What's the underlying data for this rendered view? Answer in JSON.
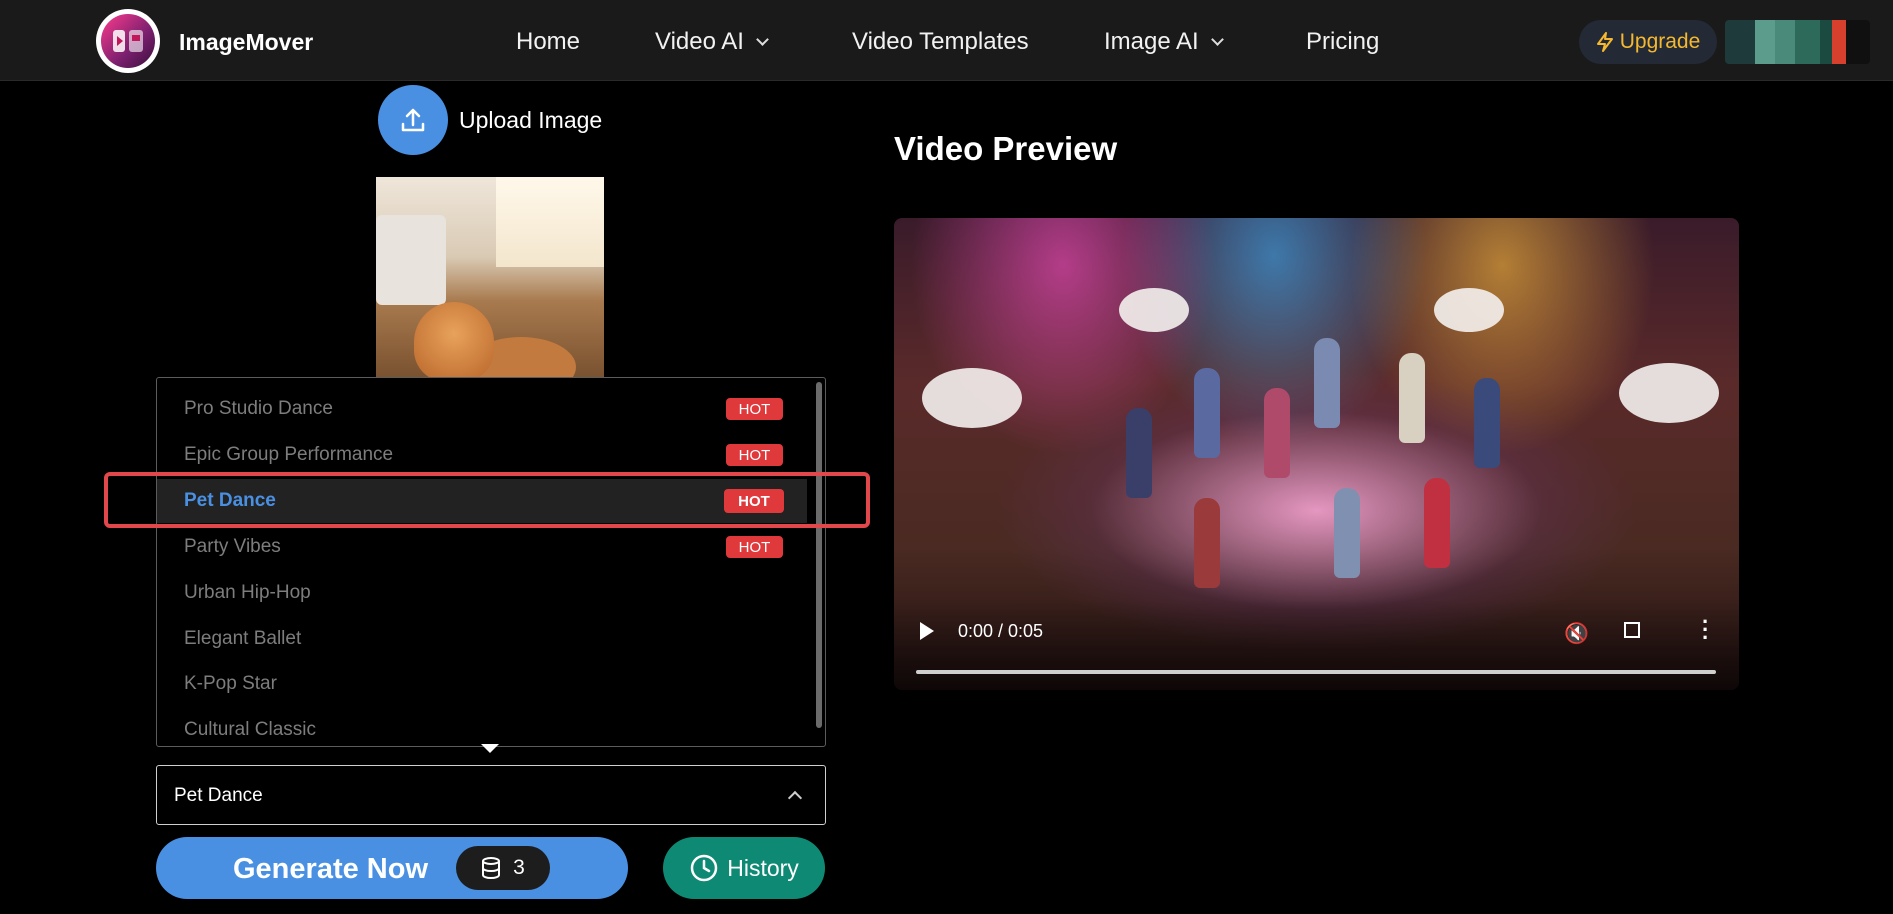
{
  "header": {
    "brand": "ImageMover",
    "nav": [
      {
        "label": "Home"
      },
      {
        "label": "Video AI"
      },
      {
        "label": "Video Templates"
      },
      {
        "label": "Image AI"
      },
      {
        "label": "Pricing"
      }
    ],
    "upgrade_label": "Upgrade"
  },
  "upload": {
    "label": "Upload Image"
  },
  "templates": {
    "options": [
      {
        "label": "Pro Studio Dance",
        "badge": "HOT"
      },
      {
        "label": "Epic Group Performance",
        "badge": "HOT"
      },
      {
        "label": "Pet Dance",
        "badge": "HOT",
        "selected": true
      },
      {
        "label": "Party Vibes",
        "badge": "HOT"
      },
      {
        "label": "Urban Hip-Hop"
      },
      {
        "label": "Elegant Ballet"
      },
      {
        "label": "K-Pop Star"
      },
      {
        "label": "Cultural Classic"
      }
    ],
    "selected_value": "Pet Dance"
  },
  "actions": {
    "generate_label": "Generate Now",
    "credits": "3",
    "history_label": "History"
  },
  "preview": {
    "title": "Video Preview",
    "time": "0:00 / 0:05",
    "progress": 0
  },
  "colors": {
    "accent": "#4a90e2",
    "hot": "#e0393c",
    "history": "#0e8a74",
    "upgrade_text": "#f5b82e",
    "highlight": "#e2474b"
  }
}
